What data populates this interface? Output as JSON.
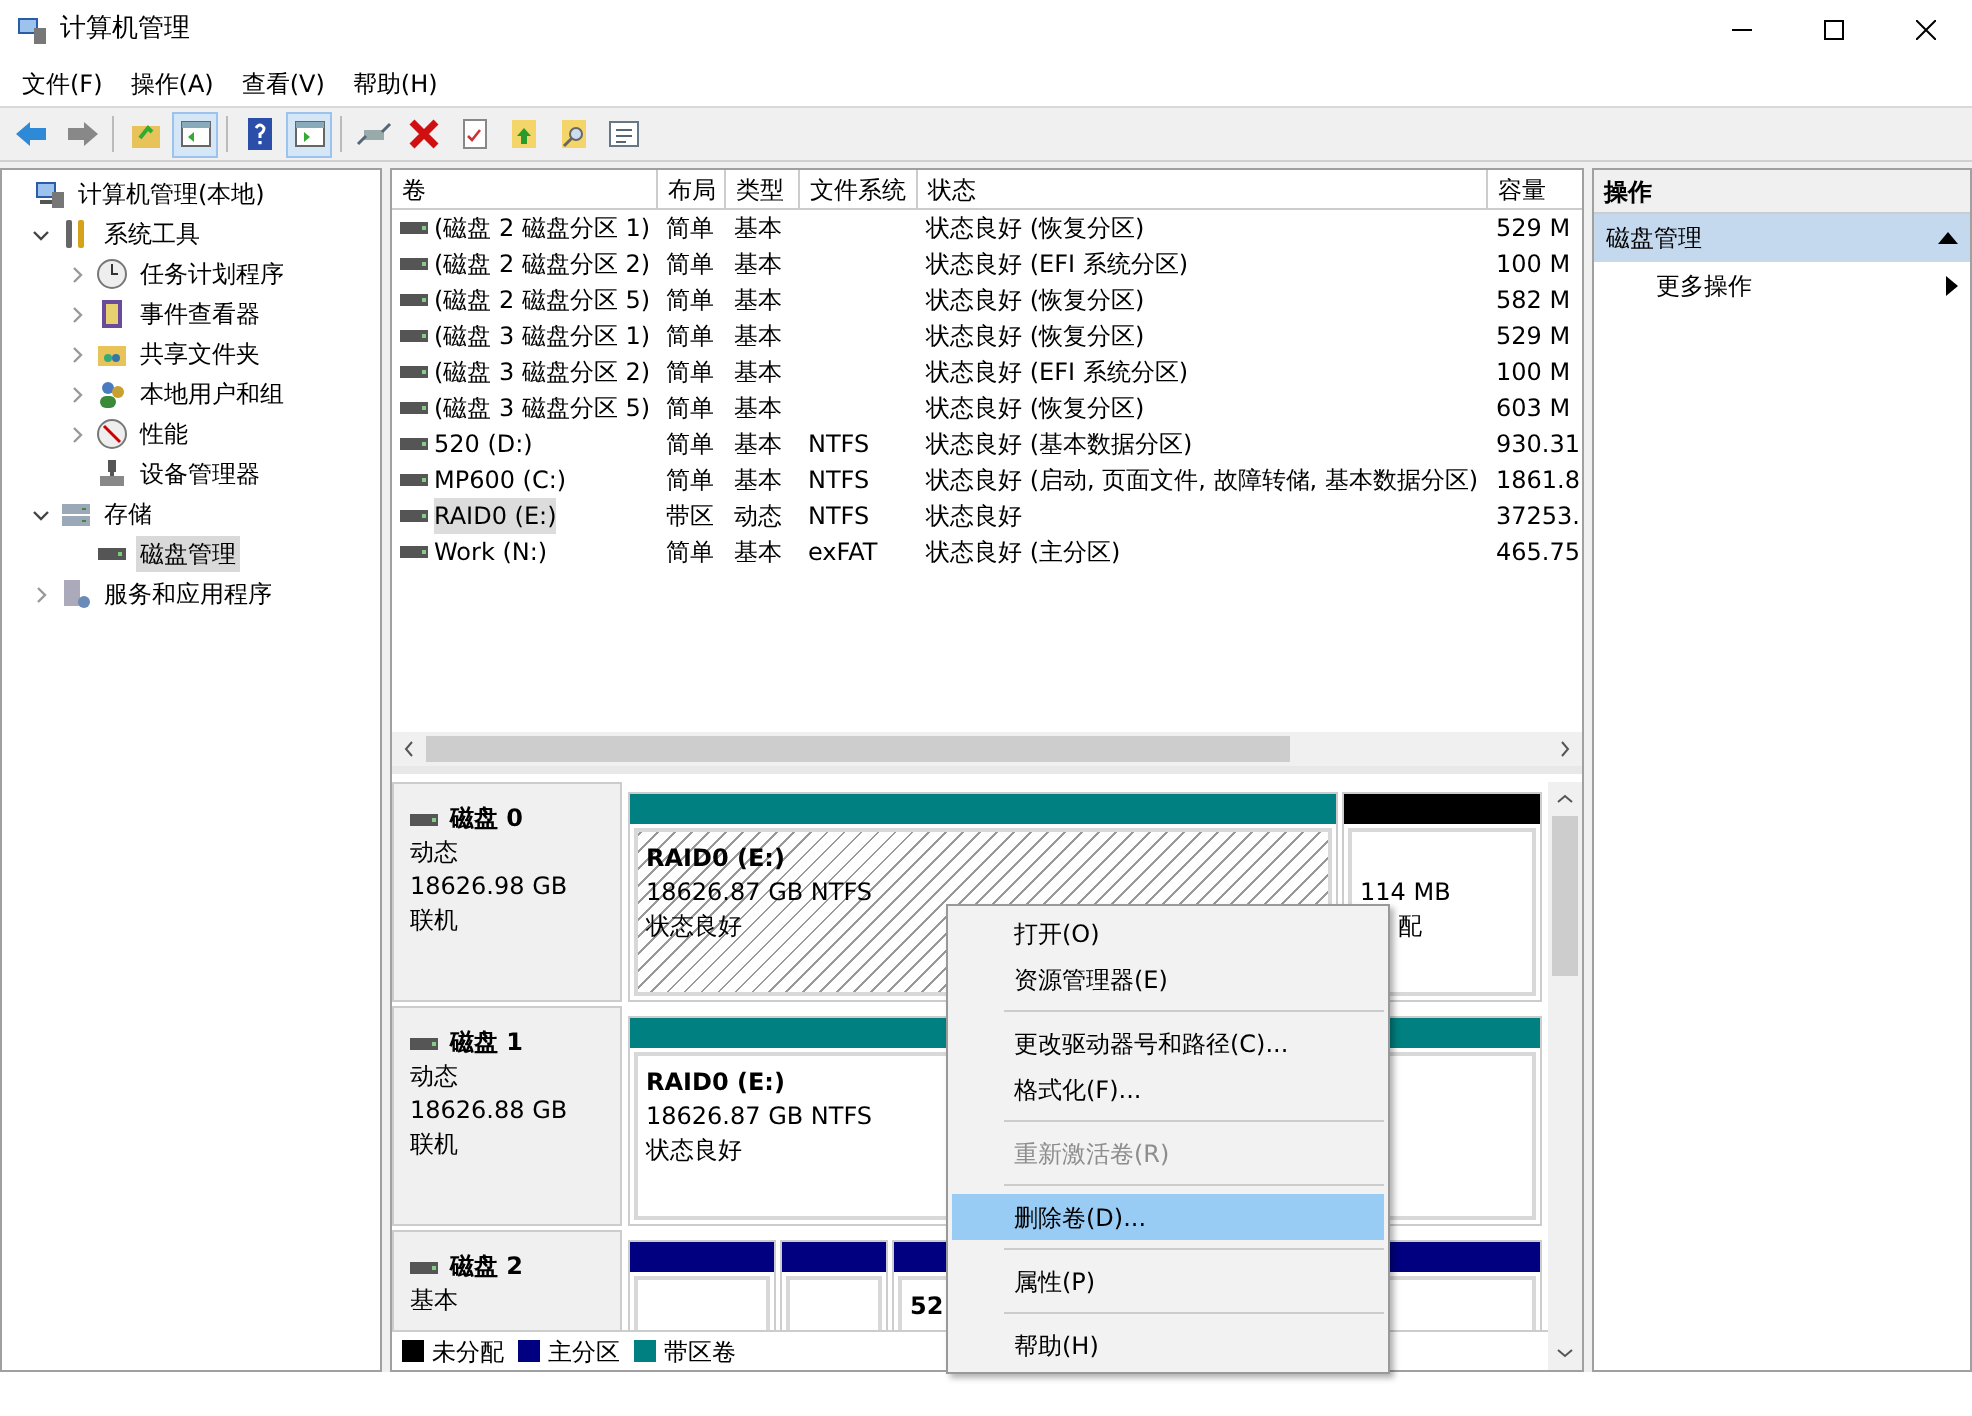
{
  "window": {
    "title": "计算机管理"
  },
  "menu": [
    "文件(F)",
    "操作(A)",
    "查看(V)",
    "帮助(H)"
  ],
  "toolbar": [
    {
      "kind": "back",
      "pressed": false,
      "disabled": false
    },
    {
      "kind": "forward",
      "pressed": false,
      "disabled": true
    },
    {
      "kind": "up",
      "pressed": false
    },
    {
      "kind": "tree",
      "pressed": true
    },
    {
      "kind": "help",
      "pressed": false
    },
    {
      "kind": "pane",
      "pressed": true
    },
    {
      "kind": "connect",
      "pressed": false
    },
    {
      "kind": "delete",
      "pressed": false
    },
    {
      "kind": "properties",
      "pressed": false
    },
    {
      "kind": "export",
      "pressed": false
    },
    {
      "kind": "find",
      "pressed": false
    },
    {
      "kind": "list",
      "pressed": false
    }
  ],
  "tree": [
    {
      "label": "计算机管理(本地)",
      "kind": "computer",
      "selected": false,
      "children": [
        {
          "label": "系统工具",
          "kind": "tools",
          "selected": false,
          "expanded": true,
          "children": [
            {
              "label": "任务计划程序",
              "kind": "clock",
              "selected": false,
              "expanded": false
            },
            {
              "label": "事件查看器",
              "kind": "log",
              "selected": false,
              "expanded": false
            },
            {
              "label": "共享文件夹",
              "kind": "share",
              "selected": false,
              "expanded": false
            },
            {
              "label": "本地用户和组",
              "kind": "users",
              "selected": false,
              "expanded": false
            },
            {
              "label": "性能",
              "kind": "gauge",
              "selected": false,
              "expanded": false
            },
            {
              "label": "设备管理器",
              "kind": "device",
              "selected": false
            }
          ]
        },
        {
          "label": "存储",
          "kind": "storage",
          "selected": false,
          "expanded": true,
          "children": [
            {
              "label": "磁盘管理",
              "kind": "disk",
              "selected": true
            }
          ]
        },
        {
          "label": "服务和应用程序",
          "kind": "services",
          "selected": false,
          "expanded": false
        }
      ]
    }
  ],
  "volumes": {
    "columns": [
      "卷",
      "布局",
      "类型",
      "文件系统",
      "状态",
      "容量"
    ],
    "rows": [
      {
        "selected": false,
        "cells": [
          "(磁盘 2 磁盘分区 1)",
          "简单",
          "基本",
          "",
          "状态良好 (恢复分区)",
          "529 M"
        ]
      },
      {
        "selected": false,
        "cells": [
          "(磁盘 2 磁盘分区 2)",
          "简单",
          "基本",
          "",
          "状态良好 (EFI 系统分区)",
          "100 M"
        ]
      },
      {
        "selected": false,
        "cells": [
          "(磁盘 2 磁盘分区 5)",
          "简单",
          "基本",
          "",
          "状态良好 (恢复分区)",
          "582 M"
        ]
      },
      {
        "selected": false,
        "cells": [
          "(磁盘 3 磁盘分区 1)",
          "简单",
          "基本",
          "",
          "状态良好 (恢复分区)",
          "529 M"
        ]
      },
      {
        "selected": false,
        "cells": [
          "(磁盘 3 磁盘分区 2)",
          "简单",
          "基本",
          "",
          "状态良好 (EFI 系统分区)",
          "100 M"
        ]
      },
      {
        "selected": false,
        "cells": [
          "(磁盘 3 磁盘分区 5)",
          "简单",
          "基本",
          "",
          "状态良好 (恢复分区)",
          "603 M"
        ]
      },
      {
        "selected": false,
        "cells": [
          "520 (D:)",
          "简单",
          "基本",
          "NTFS",
          "状态良好 (基本数据分区)",
          "930.31"
        ]
      },
      {
        "selected": false,
        "cells": [
          "MP600 (C:)",
          "简单",
          "基本",
          "NTFS",
          "状态良好 (启动, 页面文件, 故障转储, 基本数据分区)",
          "1861.8"
        ]
      },
      {
        "selected": true,
        "cells": [
          "RAID0 (E:)",
          "带区",
          "动态",
          "NTFS",
          "状态良好",
          "37253."
        ]
      },
      {
        "selected": false,
        "cells": [
          "Work (N:)",
          "简单",
          "基本",
          "exFAT",
          "状态良好 (主分区)",
          "465.75"
        ]
      }
    ]
  },
  "disks": [
    {
      "name": "磁盘 0",
      "type": "动态",
      "size": "18626.98 GB",
      "status": "联机",
      "partitions": [
        {
          "color": "#008080",
          "selected": true,
          "name": "RAID0  (E:)",
          "size": "18626.87 GB NTFS",
          "status": "状态良好"
        },
        {
          "color": "#000000",
          "selected": false,
          "size": "114 MB",
          "status": "配"
        }
      ]
    },
    {
      "name": "磁盘 1",
      "type": "动态",
      "size": "18626.88 GB",
      "status": "联机",
      "partitions": [
        {
          "color": "#008080",
          "selected": false,
          "name": "RAID0  (E:)",
          "size": "18626.87 GB NTFS",
          "status": "状态良好"
        }
      ]
    },
    {
      "name": "磁盘 2",
      "type": "基本",
      "partitions": [
        {
          "color": "#000080",
          "selected": false
        },
        {
          "color": "#000080",
          "selected": false
        },
        {
          "color": "#000080",
          "selected": false,
          "name": "52"
        }
      ]
    }
  ],
  "legend": [
    {
      "label": "未分配",
      "color": "#000000"
    },
    {
      "label": "主分区",
      "color": "#000080"
    },
    {
      "label": "带区卷",
      "color": "#008080"
    }
  ],
  "actions": {
    "title": "操作",
    "section": "磁盘管理",
    "items": [
      "更多操作"
    ]
  },
  "context_menu": [
    {
      "kind": "item",
      "label": "打开(O)",
      "selected": false,
      "disabled": false
    },
    {
      "kind": "item",
      "label": "资源管理器(E)",
      "selected": false,
      "disabled": false
    },
    {
      "kind": "separator"
    },
    {
      "kind": "item",
      "label": "更改驱动器号和路径(C)...",
      "selected": false,
      "disabled": false
    },
    {
      "kind": "item",
      "label": "格式化(F)...",
      "selected": false,
      "disabled": false
    },
    {
      "kind": "separator"
    },
    {
      "kind": "item",
      "label": "重新激活卷(R)",
      "selected": false,
      "disabled": true
    },
    {
      "kind": "separator"
    },
    {
      "kind": "item",
      "label": "删除卷(D)...",
      "selected": true,
      "disabled": false
    },
    {
      "kind": "separator"
    },
    {
      "kind": "item",
      "label": "属性(P)",
      "selected": false,
      "disabled": false
    },
    {
      "kind": "separator"
    },
    {
      "kind": "item",
      "label": "帮助(H)",
      "selected": false,
      "disabled": false
    }
  ]
}
